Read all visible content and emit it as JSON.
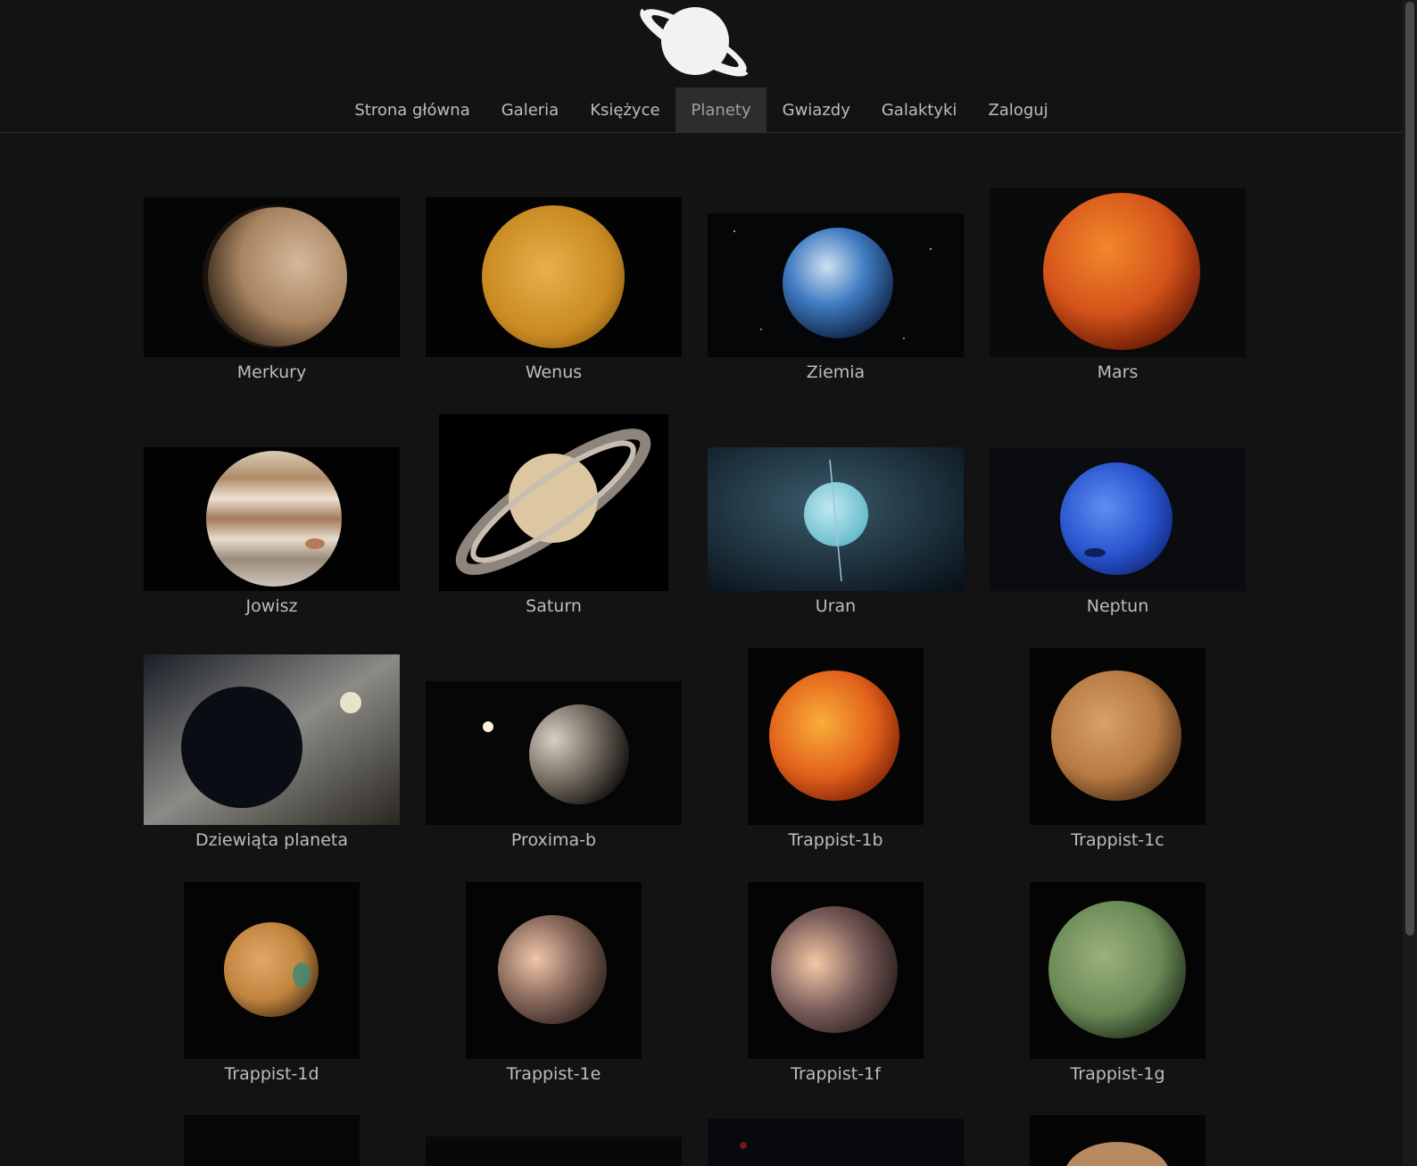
{
  "nav": {
    "items": [
      "Strona główna",
      "Galeria",
      "Księżyce",
      "Planety",
      "Gwiazdy",
      "Galaktyki",
      "Zaloguj"
    ],
    "active": "Planety"
  },
  "planets": [
    {
      "name": "Merkury"
    },
    {
      "name": "Wenus"
    },
    {
      "name": "Ziemia"
    },
    {
      "name": "Mars"
    },
    {
      "name": "Jowisz"
    },
    {
      "name": "Saturn"
    },
    {
      "name": "Uran"
    },
    {
      "name": "Neptun"
    },
    {
      "name": "Dziewiąta planeta"
    },
    {
      "name": "Proxima-b"
    },
    {
      "name": "Trappist-1b"
    },
    {
      "name": "Trappist-1c"
    },
    {
      "name": "Trappist-1d"
    },
    {
      "name": "Trappist-1e"
    },
    {
      "name": "Trappist-1f"
    },
    {
      "name": "Trappist-1g"
    }
  ],
  "colors": {
    "background": "#131314",
    "nav_active_bg": "#2d2d2e",
    "text": "#bdbdbd"
  }
}
